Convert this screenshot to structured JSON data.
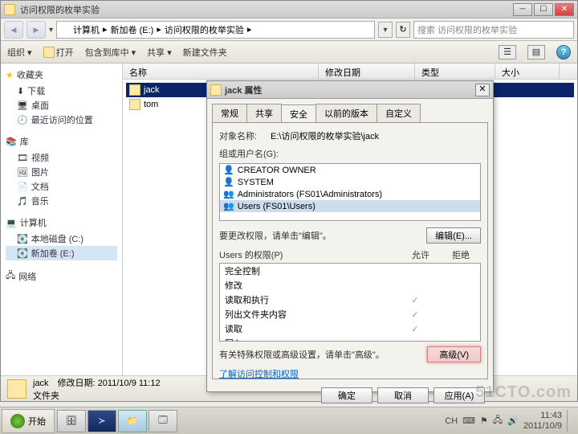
{
  "window": {
    "title": "访问权限的枚举实验",
    "path_parts": [
      "计算机",
      "新加卷 (E:)",
      "访问权限的枚举实验"
    ],
    "path_sep": " ▸ ",
    "search_placeholder": "搜索 访问权限的枚举实验"
  },
  "toolbar": {
    "organize": "组织 ▾",
    "open": "打开",
    "include": "包含到库中 ▾",
    "share": "共享 ▾",
    "newfolder": "新建文件夹"
  },
  "columns": {
    "name": "名称",
    "date": "修改日期",
    "type": "类型",
    "size": "大小"
  },
  "sidebar": {
    "favorites": {
      "hdr": "收藏夹",
      "items": [
        "下载",
        "桌面",
        "最近访问的位置"
      ]
    },
    "libraries": {
      "hdr": "库",
      "items": [
        "视频",
        "图片",
        "文档",
        "音乐"
      ]
    },
    "computer": {
      "hdr": "计算机",
      "items": [
        "本地磁盘 (C:)",
        "新加卷 (E:)"
      ],
      "selected": 1
    },
    "network": {
      "hdr": "网络"
    }
  },
  "files": [
    "jack",
    "tom"
  ],
  "status": {
    "name": "jack",
    "datelabel": "修改日期:",
    "date": "2011/10/9 11:12",
    "type": "文件夹"
  },
  "dialog": {
    "title": "jack 属性",
    "tabs": [
      "常规",
      "共享",
      "安全",
      "以前的版本",
      "自定义"
    ],
    "active_tab": 2,
    "object_label": "对象名称:",
    "object_path": "E:\\访问权限的枚举实验\\jack",
    "group_label": "组或用户名(G):",
    "principals": [
      "CREATOR OWNER",
      "SYSTEM",
      "Administrators (FS01\\Administrators)",
      "Users (FS01\\Users)"
    ],
    "selected_principal": 3,
    "edit_hint": "要更改权限，请单击\"编辑\"。",
    "edit_btn": "编辑(E)...",
    "perm_list_label": "Users 的权限(P)",
    "allow": "允许",
    "deny": "拒绝",
    "perms": [
      {
        "name": "完全控制",
        "allow": false,
        "deny": false
      },
      {
        "name": "修改",
        "allow": false,
        "deny": false
      },
      {
        "name": "读取和执行",
        "allow": true,
        "deny": false
      },
      {
        "name": "列出文件夹内容",
        "allow": true,
        "deny": false
      },
      {
        "name": "读取",
        "allow": true,
        "deny": false
      },
      {
        "name": "写入",
        "allow": false,
        "deny": false
      }
    ],
    "adv_hint": "有关特殊权限或高级设置，请单击\"高级\"。",
    "adv_btn": "高级(V)",
    "learn_link": "了解访问控制和权限",
    "ok": "确定",
    "cancel": "取消",
    "apply": "应用(A)"
  },
  "taskbar": {
    "start": "开始",
    "lang": "CH",
    "time": "11:43",
    "date": "2011/10/9"
  },
  "watermark": "51CTO.com"
}
